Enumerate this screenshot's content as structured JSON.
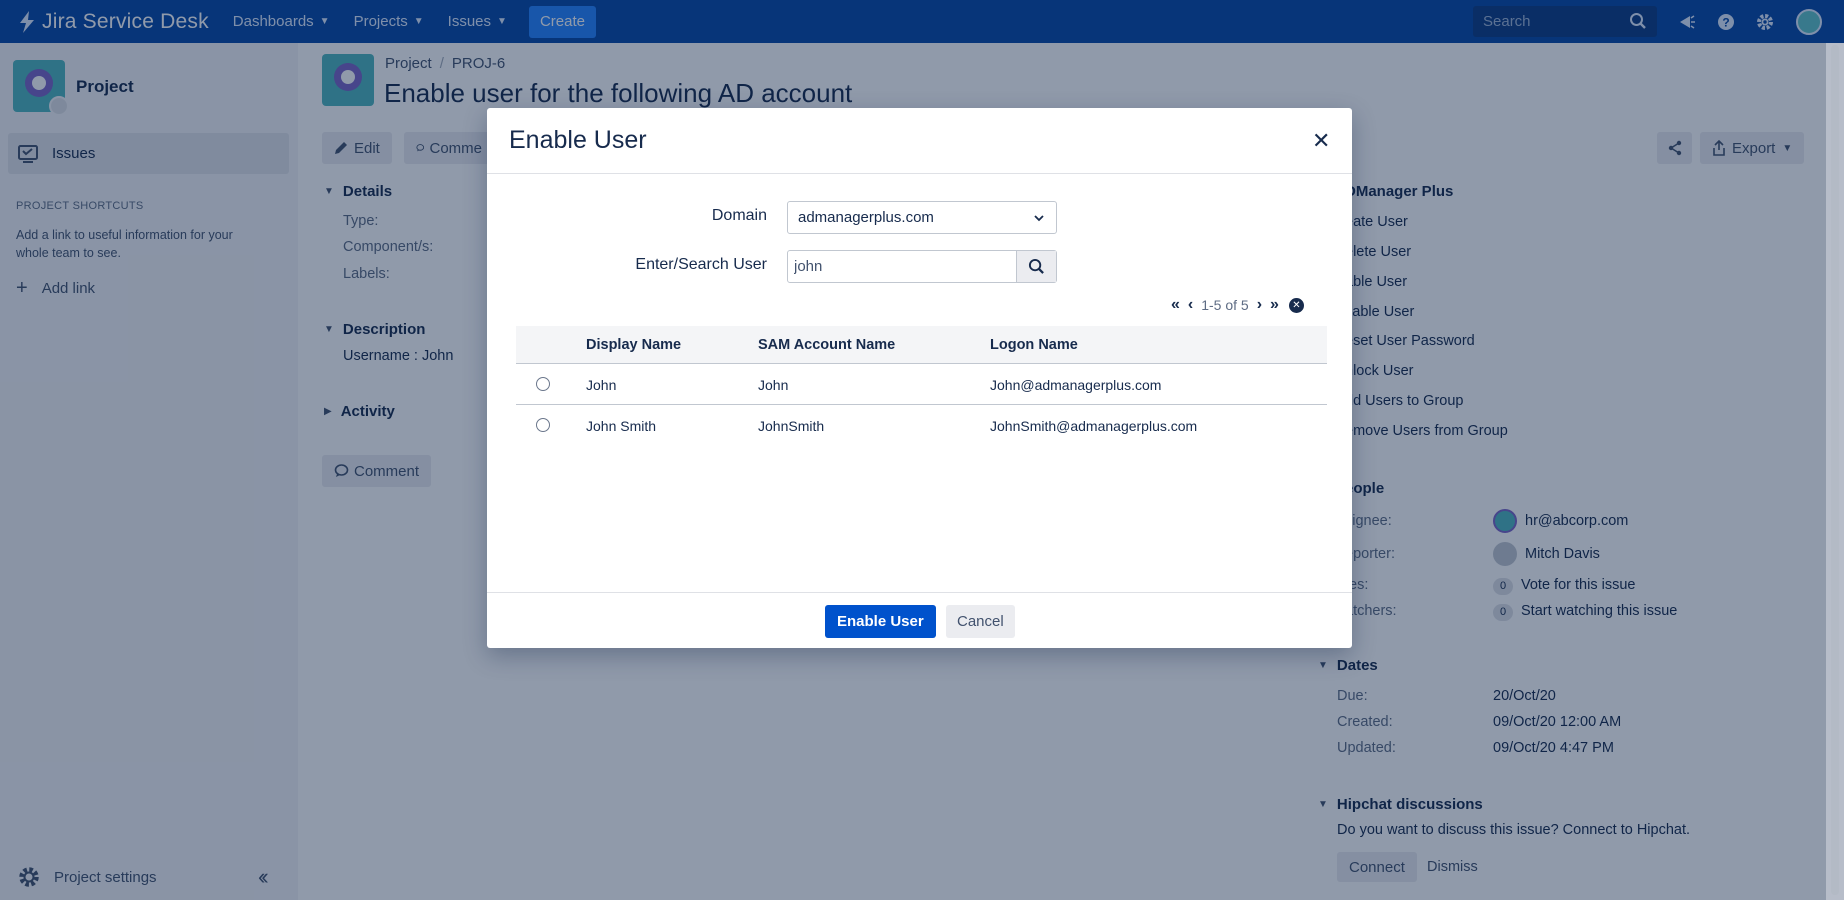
{
  "topnav": {
    "logo": "Jira Service Desk",
    "items": [
      "Dashboards",
      "Projects",
      "Issues"
    ],
    "create": "Create",
    "search_placeholder": "Search"
  },
  "sidebar": {
    "project_name": "Project",
    "issues": "Issues",
    "shortcuts_heading": "PROJECT SHORTCUTS",
    "shortcuts_text": "Add a link to useful information for your whole team to see.",
    "add_link": "Add link",
    "settings": "Project settings"
  },
  "issue": {
    "breadcrumb_project": "Project",
    "breadcrumb_key": "PROJ-6",
    "title": "Enable user for the following AD account",
    "edit": "Edit",
    "comment_partial": "Comme",
    "details": "Details",
    "type": "Type:",
    "components": "Component/s:",
    "labels": "Labels:",
    "description": "Description",
    "description_text": "Username : John",
    "activity": "Activity",
    "comment": "Comment",
    "export": "Export"
  },
  "right_panel": {
    "admanager_heading": "DManager Plus",
    "links": [
      "eate User",
      "elete User",
      "able User",
      "sable User",
      "eset User Password",
      "nlock User",
      "dd Users to Group",
      "emove Users from Group"
    ],
    "people": "eople",
    "assignee_label": "signee:",
    "assignee": "hr@abcorp.com",
    "reporter_label": "eporter:",
    "reporter": "Mitch Davis",
    "votes_label": "tes:",
    "votes_count": "0",
    "votes_text": "Vote for this issue",
    "watchers_label": "atchers:",
    "watchers_count": "0",
    "watchers_text": "Start watching this issue",
    "dates": "Dates",
    "due_label": "Due:",
    "due": "20/Oct/20",
    "created_label": "Created:",
    "created": "09/Oct/20 12:00 AM",
    "updated_label": "Updated:",
    "updated": "09/Oct/20 4:47 PM",
    "hipchat": "Hipchat discussions",
    "hipchat_text": "Do you want to discuss this issue? Connect to Hipchat.",
    "connect": "Connect",
    "dismiss": "Dismiss"
  },
  "modal": {
    "title": "Enable User",
    "domain_label": "Domain",
    "domain_value": "admanagerplus.com",
    "search_label": "Enter/Search User",
    "search_value": "john",
    "pager_text": "1-5 of 5",
    "columns": [
      "Display Name",
      "SAM Account Name",
      "Logon Name"
    ],
    "rows": [
      {
        "display": "John",
        "sam": "John",
        "logon": "John@admanagerplus.com"
      },
      {
        "display": "John Smith",
        "sam": "JohnSmith",
        "logon": "JohnSmith@admanagerplus.com"
      }
    ],
    "enable_btn": "Enable User",
    "cancel_btn": "Cancel"
  }
}
